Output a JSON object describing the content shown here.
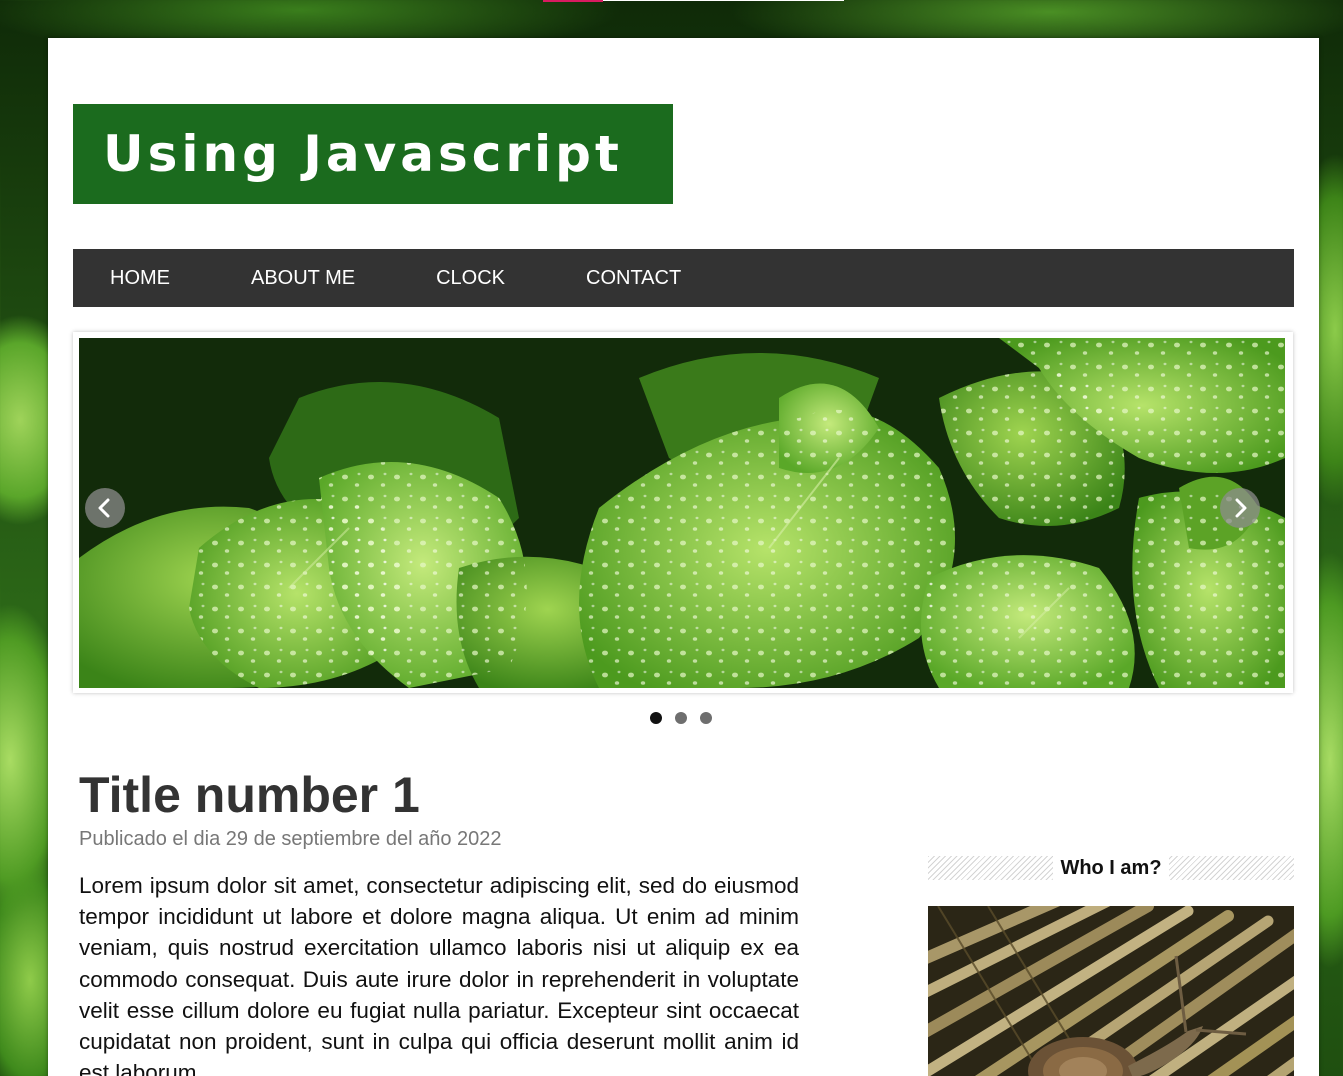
{
  "site": {
    "logo_text": "Using Javascript"
  },
  "nav": {
    "items": [
      {
        "label": "HOME"
      },
      {
        "label": "ABOUT ME"
      },
      {
        "label": "CLOCK"
      },
      {
        "label": "CONTACT"
      }
    ]
  },
  "slider": {
    "slide_count": 3,
    "active_index": 0
  },
  "post": {
    "title": "Title number 1",
    "meta": "Publicado el dia 29 de septiembre del año 2022",
    "body": "Lorem ipsum dolor sit amet, consectetur adipiscing elit, sed do eiusmod tempor incididunt ut labore et dolore magna aliqua. Ut enim ad minim veniam, quis nostrud exercitation ullamco laboris nisi ut aliquip ex ea commodo consequat. Duis aute irure dolor in reprehenderit in voluptate velit esse cillum dolore eu fugiat nulla pariatur. Excepteur sint occaecat cupidatat non proident, sunt in culpa qui officia deserunt mollit anim id est laborum."
  },
  "sidebar": {
    "heading": "Who I am?"
  },
  "colors": {
    "logo_bg": "#1b6b1e",
    "nav_bg": "#333333",
    "accent_pink": "#d81b60"
  },
  "icons": {
    "prev": "chevron-left-icon",
    "next": "chevron-right-icon"
  }
}
